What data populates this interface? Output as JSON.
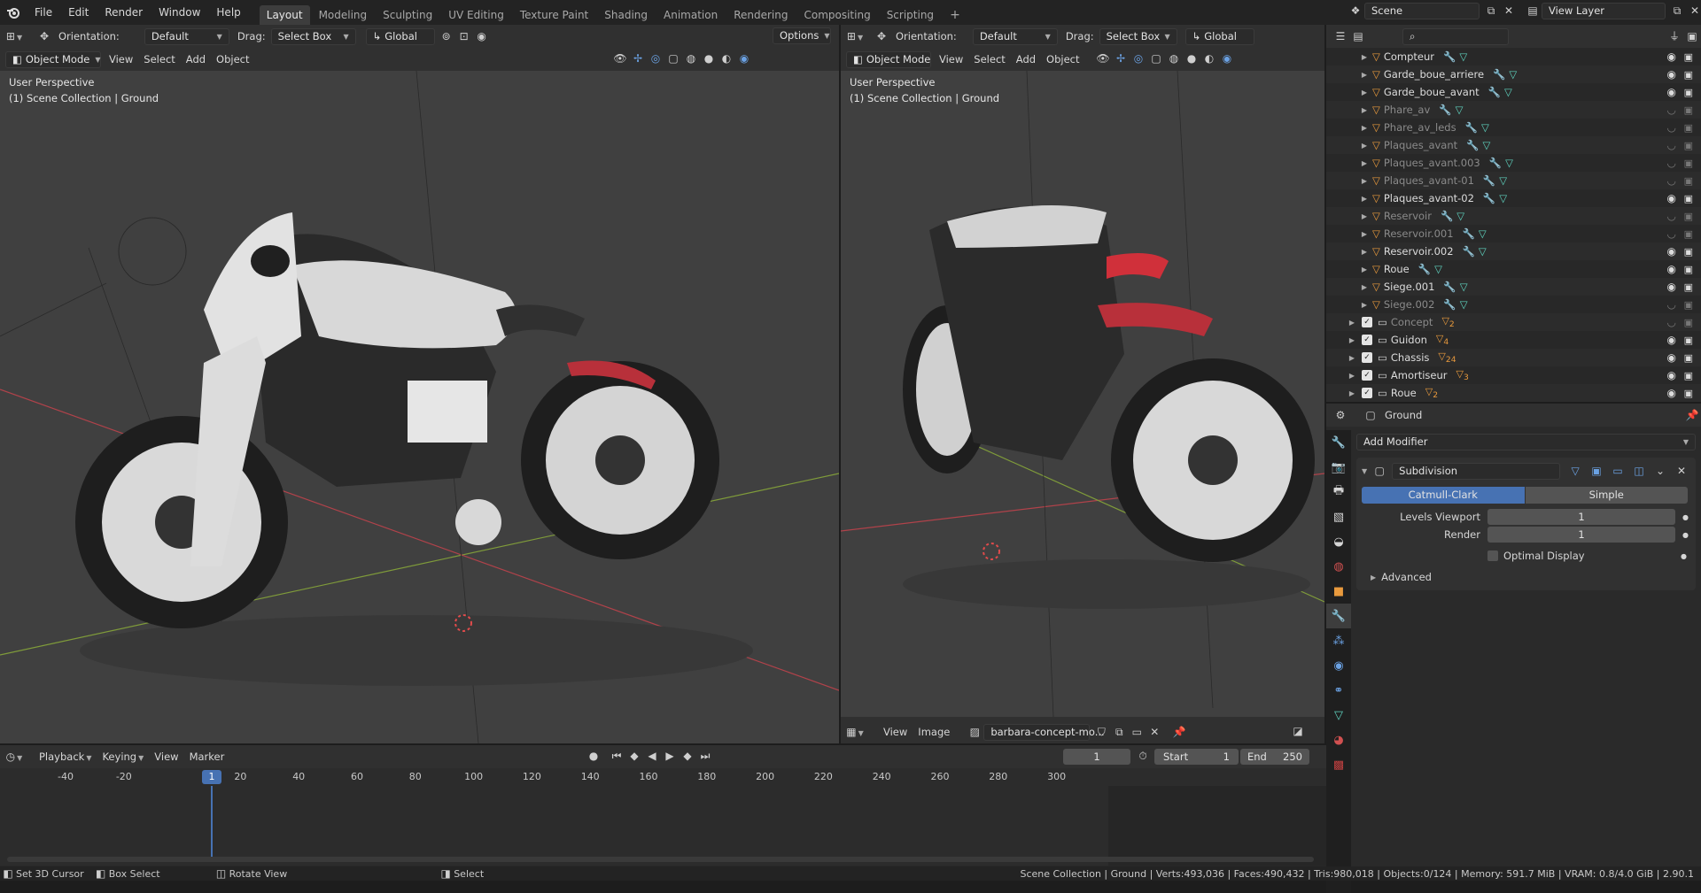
{
  "menubar": {
    "items": [
      "File",
      "Edit",
      "Render",
      "Window",
      "Help"
    ],
    "workspaces": [
      "Layout",
      "Modeling",
      "Sculpting",
      "UV Editing",
      "Texture Paint",
      "Shading",
      "Animation",
      "Rendering",
      "Compositing",
      "Scripting"
    ],
    "active_workspace": "Layout",
    "add_tab": "+",
    "scene": "Scene",
    "view_layer": "View Layer"
  },
  "left_viewport": {
    "orientation_label": "Orientation:",
    "orientation_value": "Default",
    "drag_label": "Drag:",
    "drag_value": "Select Box",
    "transform": "Global",
    "options": "Options",
    "mode": "Object Mode",
    "menus": [
      "View",
      "Select",
      "Add",
      "Object"
    ],
    "perspective": "User Perspective",
    "collection": "(1) Scene Collection | Ground"
  },
  "right_viewport": {
    "orientation_label": "Orientation:",
    "orientation_value": "Default",
    "drag_label": "Drag:",
    "drag_value": "Select Box",
    "transform": "Global",
    "mode": "Object Mode",
    "menus": [
      "View",
      "Select",
      "Add",
      "Object"
    ],
    "perspective": "User Perspective",
    "collection": "(1) Scene Collection | Ground"
  },
  "image_editor": {
    "menus": [
      "View",
      "Image"
    ],
    "image_name": "barbara-concept-mo..."
  },
  "outliner": {
    "rows": [
      {
        "name": "Compteur",
        "dim": false,
        "collection": false
      },
      {
        "name": "Garde_boue_arriere",
        "dim": false,
        "collection": false
      },
      {
        "name": "Garde_boue_avant",
        "dim": false,
        "collection": false
      },
      {
        "name": "Phare_av",
        "dim": true,
        "collection": false
      },
      {
        "name": "Phare_av_leds",
        "dim": true,
        "collection": false
      },
      {
        "name": "Plaques_avant",
        "dim": true,
        "collection": false
      },
      {
        "name": "Plaques_avant.003",
        "dim": true,
        "collection": false
      },
      {
        "name": "Plaques_avant-01",
        "dim": true,
        "collection": false
      },
      {
        "name": "Plaques_avant-02",
        "dim": false,
        "collection": false
      },
      {
        "name": "Reservoir",
        "dim": true,
        "collection": false
      },
      {
        "name": "Reservoir.001",
        "dim": true,
        "collection": false
      },
      {
        "name": "Reservoir.002",
        "dim": false,
        "collection": false
      },
      {
        "name": "Roue",
        "dim": false,
        "collection": false
      },
      {
        "name": "Siege.001",
        "dim": false,
        "collection": false
      },
      {
        "name": "Siege.002",
        "dim": true,
        "collection": false
      },
      {
        "name": "Concept",
        "dim": true,
        "collection": true,
        "badge": "2"
      },
      {
        "name": "Guidon",
        "dim": false,
        "collection": true,
        "badge": "4"
      },
      {
        "name": "Chassis",
        "dim": false,
        "collection": true,
        "badge": "24"
      },
      {
        "name": "Amortiseur",
        "dim": false,
        "collection": true,
        "badge": "3"
      },
      {
        "name": "Roue",
        "dim": false,
        "collection": true,
        "badge": "2"
      }
    ]
  },
  "properties": {
    "object_name": "Ground",
    "add_modifier": "Add Modifier",
    "modifier_name": "Subdivision",
    "tab_catmull": "Catmull-Clark",
    "tab_simple": "Simple",
    "levels_viewport_label": "Levels Viewport",
    "levels_viewport_value": "1",
    "render_label": "Render",
    "render_value": "1",
    "optimal_display": "Optimal Display",
    "advanced": "Advanced"
  },
  "timeline": {
    "menus": [
      "Playback",
      "Keying",
      "View",
      "Marker"
    ],
    "current_frame": "1",
    "start_label": "Start",
    "start_value": "1",
    "end_label": "End",
    "end_value": "250",
    "ticks": [
      "-40",
      "-20",
      "1",
      "20",
      "40",
      "60",
      "80",
      "100",
      "120",
      "140",
      "160",
      "180",
      "200",
      "220",
      "240",
      "260",
      "280",
      "300"
    ],
    "playhead": "1"
  },
  "statusbar": {
    "hint1": "Set 3D Cursor",
    "hint2": "Box Select",
    "hint3": "Rotate View",
    "hint4": "Select",
    "stats": "Scene Collection | Ground | Verts:493,036 | Faces:490,432 | Tris:980,018 | Objects:0/124 | Memory: 591.7 MiB | VRAM: 0.8/4.0 GiB | 2.90.1"
  },
  "colors": {
    "accent": "#4772b3",
    "header": "#303030",
    "viewport": "#3f3f3f"
  }
}
